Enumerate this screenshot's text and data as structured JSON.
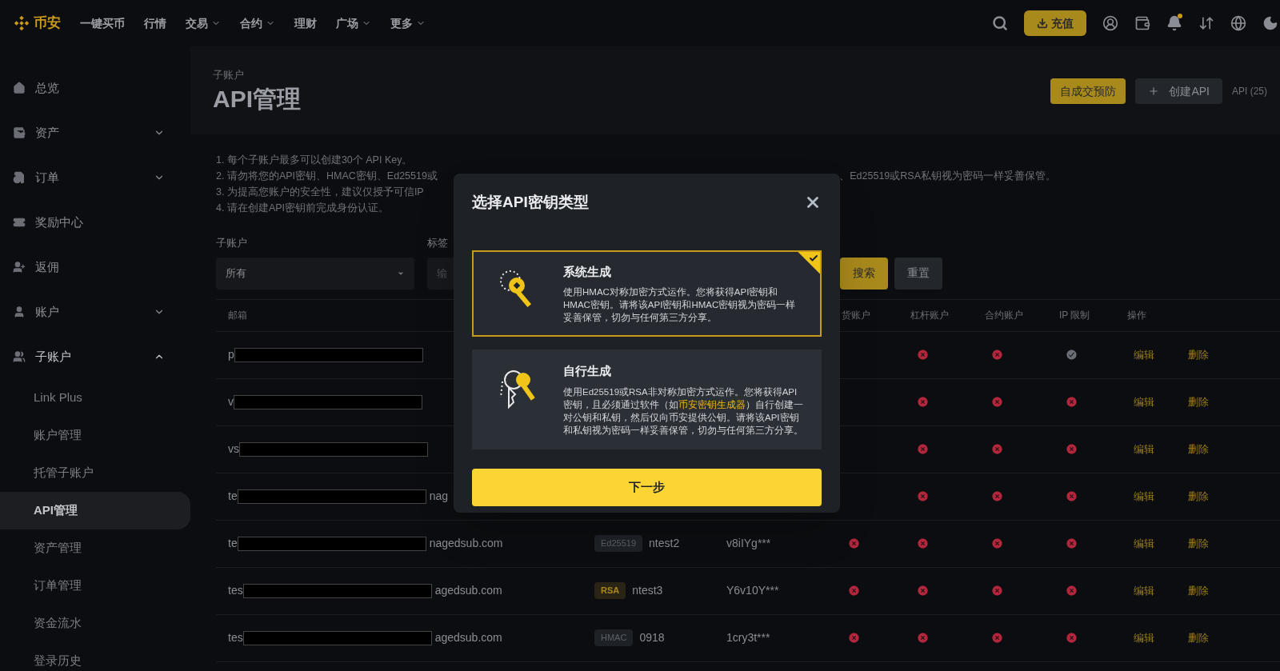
{
  "nav": {
    "logo_text": "币安",
    "items": [
      {
        "label": "一键买币",
        "dropdown": false
      },
      {
        "label": "行情",
        "dropdown": false
      },
      {
        "label": "交易",
        "dropdown": true
      },
      {
        "label": "合约",
        "dropdown": true
      },
      {
        "label": "理财",
        "dropdown": false
      },
      {
        "label": "广场",
        "dropdown": true
      },
      {
        "label": "更多",
        "dropdown": true
      }
    ],
    "deposit_button": "充值"
  },
  "sidebar": {
    "items": [
      {
        "label": "总览",
        "kind": "link"
      },
      {
        "label": "资产",
        "kind": "group",
        "expanded": false
      },
      {
        "label": "订单",
        "kind": "group",
        "expanded": false
      },
      {
        "label": "奖励中心",
        "kind": "link"
      },
      {
        "label": "返佣",
        "kind": "link"
      },
      {
        "label": "账户",
        "kind": "group",
        "expanded": false
      },
      {
        "label": "子账户",
        "kind": "group",
        "expanded": true,
        "children": [
          {
            "label": "Link Plus",
            "selected": false
          },
          {
            "label": "账户管理",
            "selected": false
          },
          {
            "label": "托管子账户",
            "selected": false
          },
          {
            "label": "API管理",
            "selected": true
          },
          {
            "label": "资产管理",
            "selected": false
          },
          {
            "label": "订单管理",
            "selected": false
          },
          {
            "label": "资金流水",
            "selected": false
          },
          {
            "label": "登录历史",
            "selected": false
          }
        ]
      }
    ]
  },
  "header": {
    "breadcrumb": "子账户",
    "title": "API管理",
    "stp_button": "自成交预防",
    "create_button": "创建API",
    "count": "API (25)"
  },
  "notes": [
    {
      "text": "1. 每个子账户最多可以创建30个 API Key。"
    },
    {
      "text": "2. 请勿将您的API密钥、HMAC密钥、Ed25519或",
      "tail": "、Ed25519或RSA私钥视为密码一样妥善保管。"
    },
    {
      "text": "3. 为提高您账户的安全性，建议仅授予可信IP"
    },
    {
      "text": "4. 请在创建API密钥前完成身份认证。"
    }
  ],
  "filters": [
    {
      "kind": "select",
      "label": "子账户",
      "value": "所有"
    },
    {
      "kind": "input",
      "label": "标签",
      "placeholder": "输"
    }
  ],
  "search_button": "搜索",
  "reset_button": "重置",
  "table": {
    "columns": [
      "邮箱",
      "货账户",
      "杠杆账户",
      "合约账户",
      "IP 限制",
      "操作"
    ],
    "rows": [
      {
        "email_prefix": "p",
        "margin": false,
        "futures": false,
        "ip": true,
        "edit": "编辑",
        "delete": "删除"
      },
      {
        "email_prefix": "v",
        "margin": false,
        "futures": false,
        "ip": false,
        "edit": "编辑",
        "delete": "删除"
      },
      {
        "email_prefix": "vs",
        "margin": false,
        "futures": false,
        "ip": false,
        "edit": "编辑",
        "delete": "删除"
      },
      {
        "email_prefix": "te",
        "email_suffix": "nag",
        "margin": false,
        "futures": false,
        "ip": false,
        "edit": "编辑",
        "delete": "删除"
      },
      {
        "email_prefix": "te",
        "email_suffix": "nagedsub.com",
        "key_type": {
          "label": "Ed25519",
          "kind": "ed25519"
        },
        "tag": "ntest2",
        "api_key": "v8iIYg***",
        "spot": false,
        "margin": false,
        "futures": false,
        "ip": false,
        "edit": "编辑",
        "delete": "删除"
      },
      {
        "email_prefix": "tes",
        "email_suffix": "agedsub.com",
        "key_type": {
          "label": "RSA",
          "kind": "rsa"
        },
        "tag": "ntest3",
        "api_key": "Y6v10Y***",
        "spot": false,
        "margin": false,
        "futures": false,
        "ip": false,
        "edit": "编辑",
        "delete": "删除"
      },
      {
        "email_prefix": "tes",
        "email_suffix": "agedsub.com",
        "key_type": {
          "label": "HMAC",
          "kind": "hmac"
        },
        "tag": "0918",
        "api_key": "1cry3t***",
        "spot": false,
        "margin": false,
        "futures": false,
        "ip": false,
        "edit": "编辑",
        "delete": "删除"
      }
    ]
  },
  "modal": {
    "title": "选择API密钥类型",
    "options": [
      {
        "title": "系统生成",
        "selected": true,
        "description": [
          {
            "text": "使用HMAC对称加密方式运作。您将获得API密钥和HMAC密钥。请将该API密钥和HMAC密钥视为密码一样妥善保管，切勿与任何第三方分享。",
            "link": false
          }
        ]
      },
      {
        "title": "自行生成",
        "selected": false,
        "description": [
          {
            "text": "使用Ed25519或RSA非对称加密方式运作。您将获得API密钥，且必须通过软件（如",
            "link": false
          },
          {
            "text": "币安密钥生成器",
            "link": true
          },
          {
            "text": "）自行创建一对公钥和私钥，然后仅向币安提供公钥。请将该API密钥和私钥视为密码一样妥善保管，切勿与任何第三方分享。",
            "link": false
          }
        ]
      }
    ],
    "next_button": "下一步"
  }
}
